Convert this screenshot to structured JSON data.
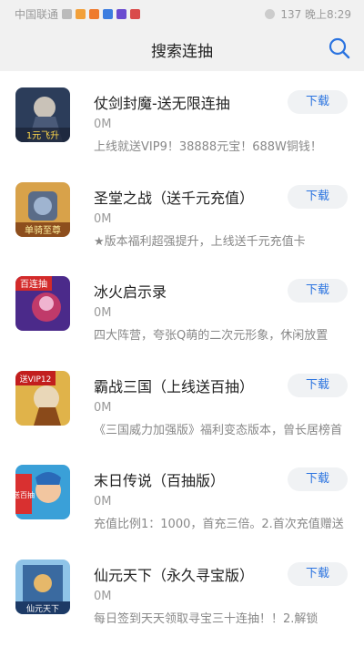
{
  "status_bar": {
    "carrier": "中国联通",
    "right_text": "137 晚上8:29",
    "battery_icon": "battery-icon",
    "signal_icon": "signal-icon",
    "wifi_icon": "wifi-icon"
  },
  "header": {
    "title": "搜索连抽",
    "search_icon": "search-icon",
    "accent_color": "#2a73e0"
  },
  "apps": [
    {
      "name": "仗剑封魔-送无限连抽",
      "size": "0M",
      "desc": "上线就送VIP9！38888元宝！688W铜钱！",
      "button": "下载",
      "icon_text": "1元飞升"
    },
    {
      "name": "圣堂之战（送千元充值）",
      "size": "0M",
      "desc": "★版本福利超强提升，上线送千元充值卡",
      "button": "下载",
      "icon_text": "单骑至尊"
    },
    {
      "name": "冰火启示录",
      "size": "0M",
      "desc": "四大阵营，夸张Q萌的二次元形象，休闲放置",
      "button": "下载",
      "icon_text": "百连抽"
    },
    {
      "name": "霸战三国（上线送百抽）",
      "size": "0M",
      "desc": "《三国威力加强版》福利变态版本，曾长居榜首",
      "button": "下载",
      "icon_text": "送VIP12"
    },
    {
      "name": "末日传说（百抽版）",
      "size": "0M",
      "desc": "充值比例1：1000，首充三倍。2.首次充值赠送",
      "button": "下载",
      "icon_text": "送百抽"
    },
    {
      "name": "仙元天下（永久寻宝版）",
      "size": "0M",
      "desc": "每日签到天天领取寻宝三十连抽！！2.解锁",
      "button": "下载",
      "icon_text": "仙元天下"
    }
  ]
}
